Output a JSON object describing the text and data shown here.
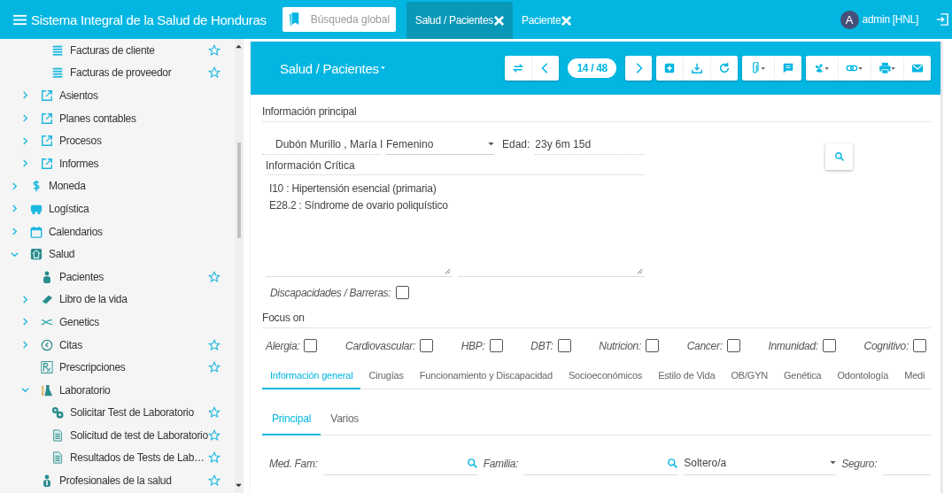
{
  "app": {
    "title": "Sistema Integral de la Salud de Honduras",
    "search": {
      "placeholder": "Búsqueda global"
    },
    "tabs": [
      {
        "label": "Salud / Pacientes",
        "selected": true
      },
      {
        "label": "Paciente",
        "selected": false
      }
    ],
    "user": {
      "avatar": "A",
      "name": "admin [HNL]"
    }
  },
  "sidebar": {
    "items": [
      {
        "children": [
          {
            "children": [
              {
                "label": "Facturas de cliente",
                "kind": "list",
                "starred": true
              },
              {
                "label": "Facturas de proveedor",
                "kind": "list",
                "starred": true
              }
            ]
          },
          {
            "label": "Asientos",
            "kind": "link",
            "expanded": false,
            "starred": false
          },
          {
            "label": "Planes contables",
            "kind": "link",
            "expanded": false,
            "starred": false
          },
          {
            "label": "Procesos",
            "kind": "link",
            "expanded": false,
            "starred": false
          },
          {
            "label": "Informes",
            "kind": "link",
            "expanded": false,
            "starred": false
          }
        ]
      },
      {
        "label": "Moneda",
        "kind": "dollar",
        "expanded": false,
        "starred": false
      },
      {
        "label": "Logística",
        "kind": "truck",
        "expanded": false,
        "starred": false
      },
      {
        "label": "Calendarios",
        "kind": "calendar",
        "expanded": false,
        "starred": false
      },
      {
        "label": "Salud",
        "kind": "health",
        "expanded": true,
        "children": [
          {
            "label": "Pacientes",
            "kind": "patient",
            "starred": true
          },
          {
            "label": "Libro de la vida",
            "kind": "book",
            "expanded": false,
            "starred": false
          },
          {
            "label": "Genetics",
            "kind": "dna",
            "expanded": false,
            "starred": false
          },
          {
            "label": "Citas",
            "kind": "clock",
            "expanded": false,
            "starred": true
          },
          {
            "label": "Prescripciones",
            "kind": "rx",
            "starred": true
          },
          {
            "label": "Laboratorio",
            "kind": "lab",
            "expanded": true,
            "children": [
              {
                "label": "Solicitar Test de Laboratorio",
                "kind": "gears",
                "starred": true
              },
              {
                "label": "Solicitud de test de Laboratorio",
                "kind": "document",
                "starred": true
              },
              {
                "label": "Resultados de Tests de Lab…",
                "kind": "document",
                "starred": true
              }
            ]
          },
          {
            "label": "Profesionales de la salud",
            "kind": "doctor",
            "starred": true
          }
        ]
      }
    ]
  },
  "panel": {
    "title": "Salud / Pacientes",
    "pager": "14 / 48",
    "main_section": "Información principal",
    "patient_name": "Dubón Murillo , María I",
    "gender": "Femenino",
    "age_label": "Edad:",
    "age": "23y 6m 15d",
    "critical_label": "Información Crítica",
    "critical_lines": [
      "I10 : Hipertensión esencial (primaria)",
      "E28.2 : Síndrome de ovario poliquístico"
    ],
    "disabilities": {
      "label": "Discapacidades / Barreras:",
      "checked": false
    },
    "focus_title": "Focus on",
    "focus": [
      {
        "label": "Alergia:",
        "checked": false
      },
      {
        "label": "Cardiovascular:",
        "checked": false
      },
      {
        "label": "HBP:",
        "checked": false
      },
      {
        "label": "DBT:",
        "checked": false
      },
      {
        "label": "Nutricion:",
        "checked": false
      },
      {
        "label": "Cancer:",
        "checked": false
      },
      {
        "label": "Inmunidad:",
        "checked": false
      },
      {
        "label": "Cognitivo:",
        "checked": false
      }
    ],
    "tabs": [
      {
        "label": "Información general",
        "selected": true
      },
      {
        "label": "Cirugías",
        "selected": false
      },
      {
        "label": "Funcionamiento y Discapacidad",
        "selected": false
      },
      {
        "label": "Socioeconómicos",
        "selected": false
      },
      {
        "label": "Estilo de Vida",
        "selected": false
      },
      {
        "label": "OB/GYN",
        "selected": false
      },
      {
        "label": "Genética",
        "selected": false
      },
      {
        "label": "Odontología",
        "selected": false
      },
      {
        "label": "Medi",
        "selected": false
      }
    ],
    "subtabs": [
      {
        "label": "Principal",
        "selected": true
      },
      {
        "label": "Varios",
        "selected": false
      }
    ],
    "fields": [
      {
        "kind": "lookup",
        "label": "Med. Fam:"
      },
      {
        "kind": "lookup",
        "label": "Familia:"
      },
      {
        "kind": "select",
        "value": "Soltero/a"
      },
      {
        "kind": "text",
        "label": "Seguro:"
      }
    ]
  }
}
